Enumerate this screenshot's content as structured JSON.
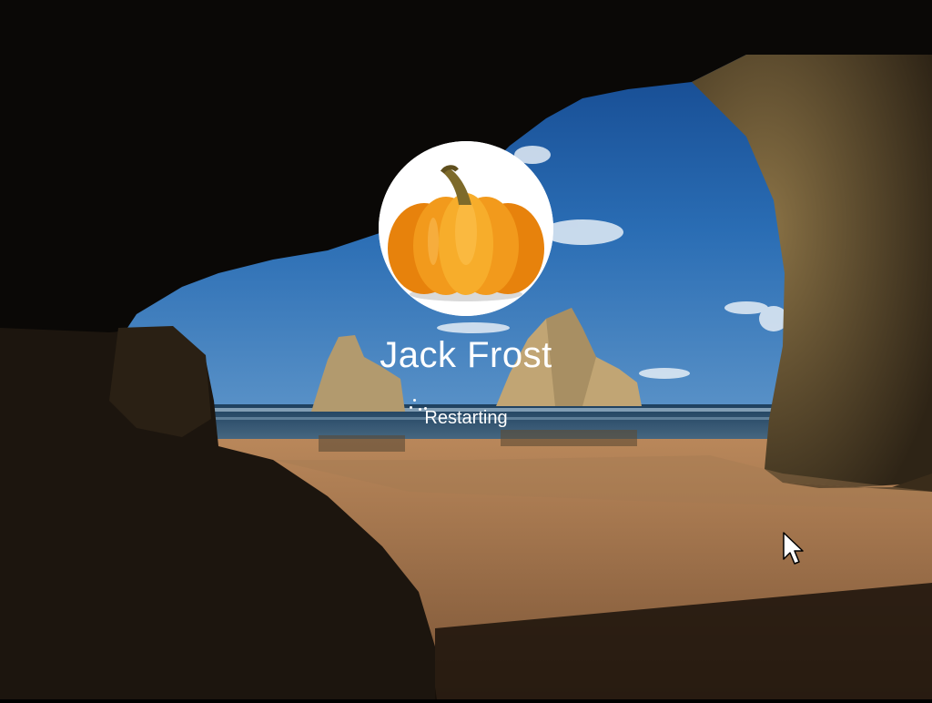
{
  "user": {
    "name": "Jack Frost",
    "avatar_icon": "pumpkin-icon"
  },
  "status": {
    "text": "Restarting",
    "indicator_icon": "loading-spinner-icon"
  },
  "cursor": {
    "icon": "mouse-pointer-icon"
  }
}
